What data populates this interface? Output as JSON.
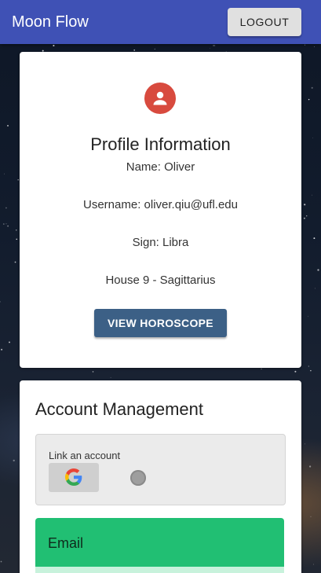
{
  "appbar": {
    "title": "Moon Flow",
    "logout_label": "LOGOUT"
  },
  "profile": {
    "avatar_icon": "account-circle-icon",
    "title": "Profile Information",
    "name_line": "Name: Oliver",
    "username_line": "Username: oliver.qiu@ufl.edu",
    "sign_line": "Sign: Libra",
    "house_line": "House 9 - Sagittarius",
    "horoscope_button": "VIEW HOROSCOPE"
  },
  "account": {
    "title": "Account Management",
    "link_label": "Link an account",
    "google_icon": "google-icon",
    "email_label": "Email"
  },
  "colors": {
    "appbar": "#3f51b5",
    "avatar": "#d84a3e",
    "horoscope_button": "#3c6086",
    "email_panel": "#21bf73"
  }
}
